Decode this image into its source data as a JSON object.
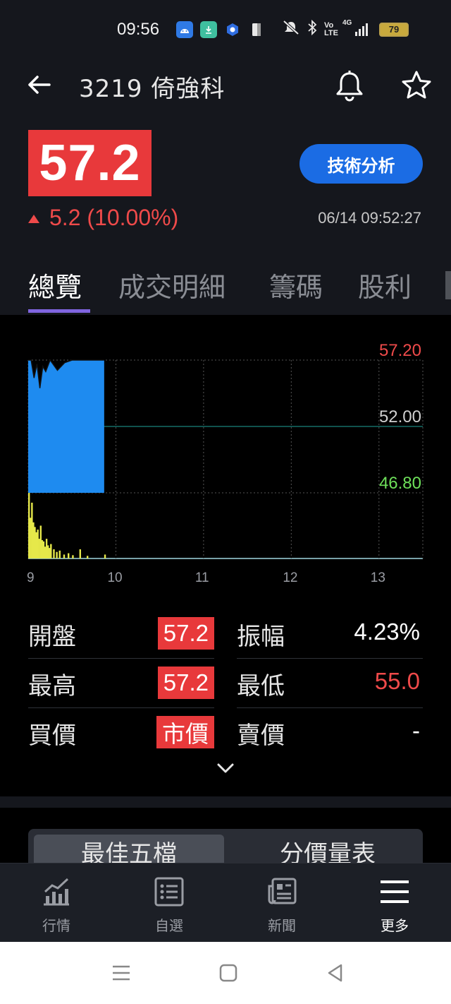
{
  "status_bar": {
    "time": "09:56",
    "battery": "79",
    "network": "4G",
    "volte": "Vo LTE"
  },
  "header": {
    "title": "3219 倚強科",
    "price": "57.2",
    "change": "5.2 (10.00%)",
    "timestamp": "06/14 09:52:27",
    "tech_button": "技術分析"
  },
  "tabs": [
    {
      "label": "總覽",
      "active": true
    },
    {
      "label": "成交明細",
      "active": false
    },
    {
      "label": "籌碼",
      "active": false
    },
    {
      "label": "股利",
      "active": false
    }
  ],
  "chart_data": {
    "type": "area",
    "y_labels": [
      "57.20",
      "52.00",
      "46.80"
    ],
    "x_ticks": [
      "9",
      "10",
      "11",
      "12",
      "13"
    ],
    "reference_price": 52.0,
    "ylim": [
      46.8,
      57.2
    ],
    "price_series": {
      "time": [
        "9:00",
        "9:02",
        "9:04",
        "9:06",
        "9:08",
        "9:10",
        "9:12",
        "9:15",
        "9:20",
        "9:25",
        "9:30",
        "9:35",
        "9:40",
        "9:45",
        "9:50",
        "9:52"
      ],
      "value": [
        57.2,
        57.2,
        55.8,
        56.9,
        55.0,
        56.7,
        56.3,
        57.2,
        56.4,
        57.0,
        57.2,
        57.2,
        57.2,
        57.2,
        57.2,
        57.2
      ]
    },
    "volume_series": {
      "time": [
        "9:00",
        "9:01",
        "9:02",
        "9:03",
        "9:04",
        "9:05",
        "9:06",
        "9:07",
        "9:08",
        "9:09",
        "9:10",
        "9:11",
        "9:12",
        "9:13",
        "9:14",
        "9:15",
        "9:17",
        "9:19",
        "9:21",
        "9:24",
        "9:27",
        "9:30",
        "9:35",
        "9:40",
        "9:52"
      ],
      "value": [
        100,
        62,
        85,
        55,
        48,
        40,
        44,
        30,
        50,
        28,
        26,
        18,
        30,
        20,
        16,
        22,
        14,
        10,
        12,
        6,
        8,
        5,
        14,
        4,
        6
      ]
    },
    "colors": {
      "up": "#ef4a4a",
      "down": "#6ee05a",
      "reference": "#1fa39a",
      "area": "#1e8bf0",
      "volume": "#e6e84a"
    }
  },
  "stats": {
    "open_label": "開盤",
    "open_value": "57.2",
    "amplitude_label": "振幅",
    "amplitude_value": "4.23%",
    "high_label": "最高",
    "high_value": "57.2",
    "low_label": "最低",
    "low_value": "55.0",
    "bid_label": "買價",
    "bid_value": "市價",
    "ask_label": "賣價",
    "ask_value": "-"
  },
  "order_tabs": [
    "最佳五檔",
    "分價量表"
  ],
  "bottom_nav": [
    {
      "label": "行情",
      "icon": "chart-icon",
      "active": false
    },
    {
      "label": "自選",
      "icon": "list-icon",
      "active": false
    },
    {
      "label": "新聞",
      "icon": "news-icon",
      "active": false
    },
    {
      "label": "更多",
      "icon": "menu-icon",
      "active": true
    }
  ]
}
